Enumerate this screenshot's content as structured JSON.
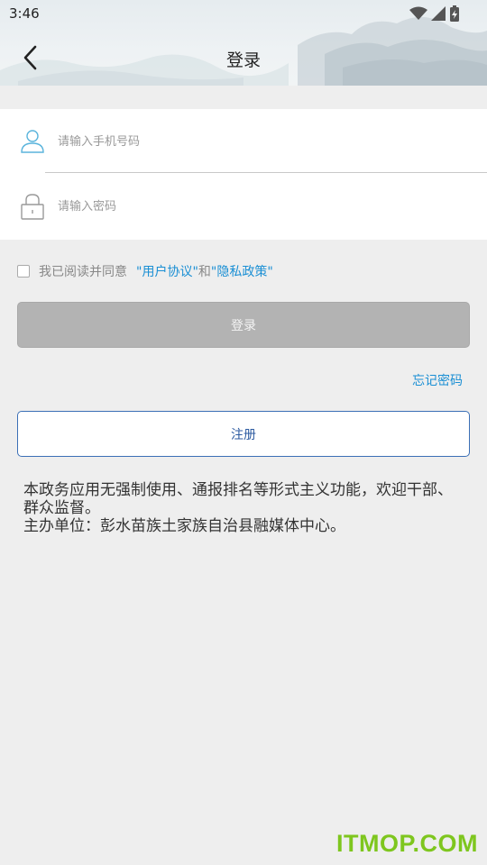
{
  "status_bar": {
    "time": "3:46"
  },
  "header": {
    "title": "登录"
  },
  "form": {
    "phone_placeholder": "请输入手机号码",
    "password_placeholder": "请输入密码"
  },
  "agreement": {
    "prefix": "我已阅读并同意",
    "user_agreement": "\"用户协议\"",
    "and": "和",
    "privacy_policy": "\"隐私政策\""
  },
  "buttons": {
    "login": "登录",
    "forgot_password": "忘记密码",
    "register": "注册"
  },
  "notice": {
    "line1": "本政务应用无强制使用、通报排名等形式主义功能，欢迎干部、群众监督。",
    "line2": "主办单位：彭水苗族土家族自治县融媒体中心。"
  },
  "watermark": "ITMOP.COM",
  "colors": {
    "link": "#1a8fd4",
    "register_border": "#3b6fb6",
    "login_disabled": "#b3b3b3",
    "watermark": "#7ec61e"
  },
  "icons": {
    "back": "chevron-left-icon",
    "phone_field": "user-icon",
    "password_field": "lock-icon",
    "wifi": "wifi-icon",
    "signal": "signal-icon",
    "battery": "battery-charging-icon"
  }
}
